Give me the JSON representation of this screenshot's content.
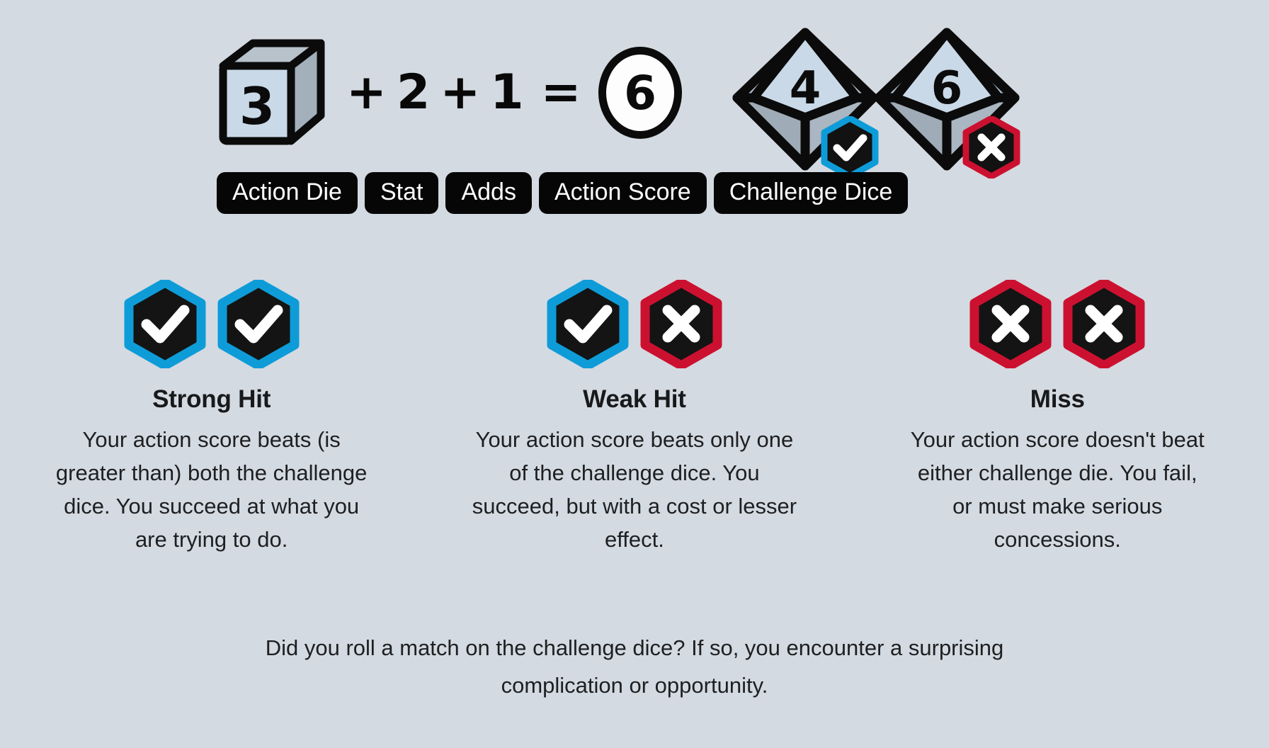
{
  "formula": {
    "action_die": {
      "label": "Action Die",
      "value": "3",
      "icon": "cube-die-icon"
    },
    "stat": {
      "label": "Stat",
      "value": "2"
    },
    "adds": {
      "label": "Adds",
      "value": "1"
    },
    "plus_sign_1": "+",
    "plus_sign_2": "+",
    "equals_sign": "=",
    "action_score": {
      "label": "Action Score",
      "value": "6",
      "icon": "circle-score-icon"
    },
    "challenge_dice": {
      "label": "Challenge Dice",
      "dice": [
        {
          "value": "4",
          "marker": "check",
          "marker_color": "#0e9cd8"
        },
        {
          "value": "6",
          "marker": "cross",
          "marker_color": "#cc1130"
        }
      ]
    }
  },
  "outcomes": [
    {
      "id": "strong-hit",
      "title": "Strong Hit",
      "description": "Your action score beats (is greater than) both the challenge dice. You succeed at what you are trying to do.",
      "markers": [
        {
          "type": "check",
          "color": "#0e9cd8"
        },
        {
          "type": "check",
          "color": "#0e9cd8"
        }
      ]
    },
    {
      "id": "weak-hit",
      "title": "Weak Hit",
      "description": "Your action score beats only one of the challenge dice. You succeed, but with a cost or lesser effect.",
      "markers": [
        {
          "type": "check",
          "color": "#0e9cd8"
        },
        {
          "type": "cross",
          "color": "#cc1130"
        }
      ]
    },
    {
      "id": "miss",
      "title": "Miss",
      "description": "Your action score doesn't beat either challenge die. You fail, or must make serious concessions.",
      "markers": [
        {
          "type": "cross",
          "color": "#cc1130"
        },
        {
          "type": "cross",
          "color": "#cc1130"
        }
      ]
    }
  ],
  "footer": {
    "note": "Did you roll a match on the challenge dice? If so, you encounter a surprising complication or opportunity."
  },
  "colors": {
    "background": "#d4dae1",
    "ink": "#0b0b0b",
    "success_blue": "#0e9cd8",
    "fail_red": "#cc1130",
    "die_face_light": "#c9d8e6",
    "die_face_mid": "#a8b4bf",
    "die_face_dark": "#98a4af"
  }
}
